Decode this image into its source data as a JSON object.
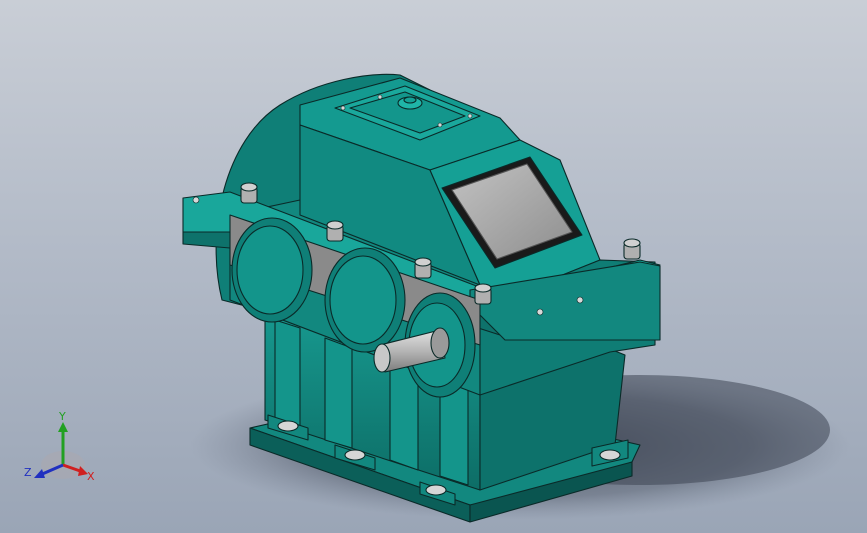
{
  "viewport": {
    "background_top": "#c9ced6",
    "background_bottom": "#9aa5b6"
  },
  "model": {
    "body_color": "#12887f",
    "body_dark": "#0b5f59",
    "body_light": "#1aa297",
    "edge_color": "#0a2a28",
    "machined_color": "#8c8c8c",
    "shaft_color": "#b9b9b9",
    "window_color": "#a7a7a7"
  },
  "triad": {
    "x_label": "X",
    "y_label": "Y",
    "z_label": "Z",
    "x_color": "#d02020",
    "y_color": "#22a022",
    "z_color": "#2030c0"
  }
}
